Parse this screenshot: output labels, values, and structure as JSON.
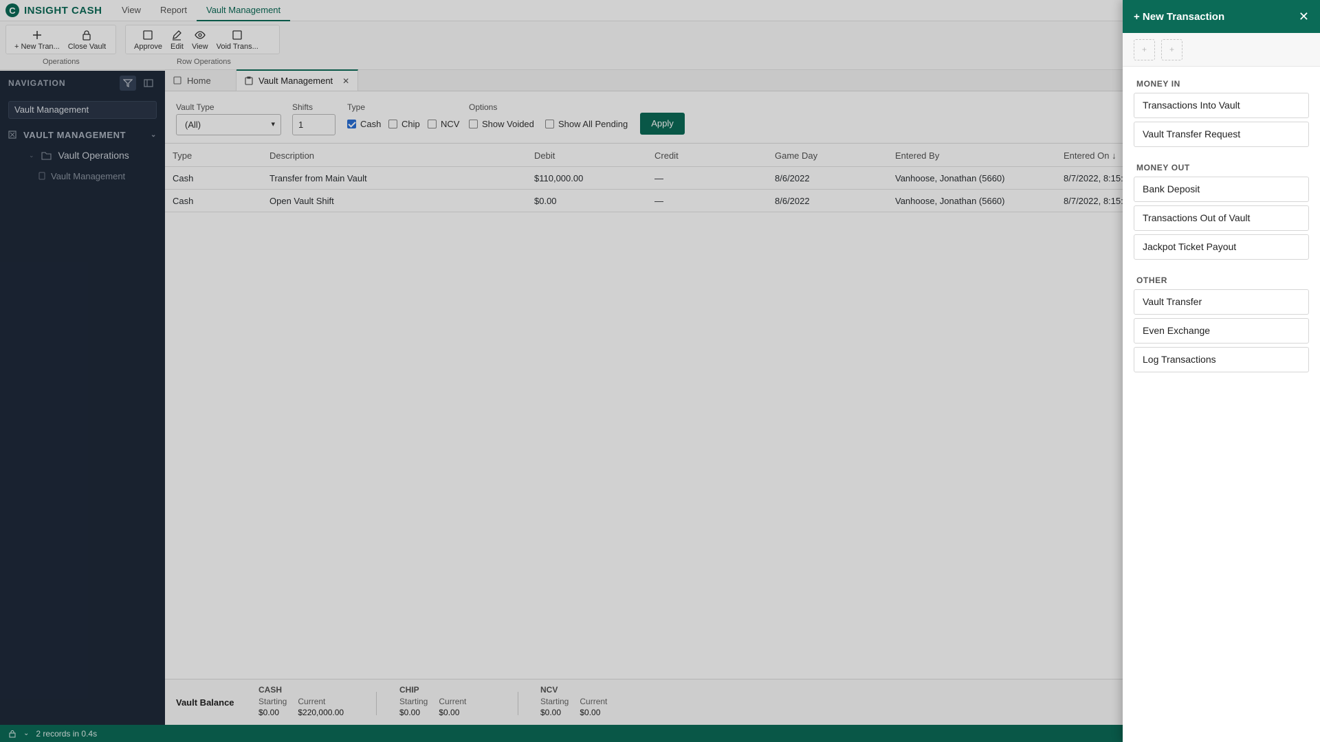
{
  "app": {
    "brand": "INSIGHT CASH",
    "menu": [
      "View",
      "Report",
      "Vault Management"
    ]
  },
  "ribbon": {
    "operations": {
      "label": "Operations",
      "new_tran": "+ New Tran...",
      "close_vault": "Close Vault"
    },
    "row_operations": {
      "label": "Row Operations",
      "approve": "Approve",
      "edit": "Edit",
      "view": "View",
      "void": "Void Trans..."
    }
  },
  "sidebar": {
    "title": "NAVIGATION",
    "search_value": "Vault Management",
    "section": "VAULT MANAGEMENT",
    "folder": "Vault Operations",
    "item": "Vault Management"
  },
  "tabs": [
    "Home",
    "Vault Management"
  ],
  "filters": {
    "vault_type_label": "Vault Type",
    "vault_type_value": "(All)",
    "shifts_label": "Shifts",
    "shifts_value": "1",
    "type_label": "Type",
    "type_cash": "Cash",
    "type_chip": "Chip",
    "type_ncv": "NCV",
    "options_label": "Options",
    "show_voided": "Show Voided",
    "show_pending": "Show All Pending",
    "apply": "Apply"
  },
  "grid": {
    "columns": [
      "Type",
      "Description",
      "Debit",
      "Credit",
      "Game Day",
      "Entered By",
      "Entered On ↓"
    ],
    "rows": [
      [
        "Cash",
        "Transfer from Main Vault",
        "$110,000.00",
        "—",
        "8/6/2022",
        "Vanhoose, Jonathan (5660)",
        "8/7/2022, 8:15:"
      ],
      [
        "Cash",
        "Open Vault Shift",
        "$0.00",
        "—",
        "8/6/2022",
        "Vanhoose, Jonathan (5660)",
        "8/7/2022, 8:15:"
      ]
    ]
  },
  "vault_balance": {
    "title": "Vault Balance",
    "starting_label": "Starting",
    "current_label": "Current",
    "cash": {
      "name": "CASH",
      "starting": "$0.00",
      "current": "$220,000.00"
    },
    "chip": {
      "name": "CHIP",
      "starting": "$0.00",
      "current": "$0.00"
    },
    "ncv": {
      "name": "NCV",
      "starting": "$0.00",
      "current": "$0.00"
    }
  },
  "status": {
    "text": "2 records in 0.4s"
  },
  "panel": {
    "title": "+ New Transaction",
    "tool_symbol": "+",
    "money_in": "MONEY IN",
    "money_in_items": [
      "Transactions Into Vault",
      "Vault Transfer Request"
    ],
    "money_out": "MONEY OUT",
    "money_out_items": [
      "Bank Deposit",
      "Transactions Out of Vault",
      "Jackpot Ticket Payout"
    ],
    "other": "OTHER",
    "other_items": [
      "Vault Transfer",
      "Even Exchange",
      "Log Transactions"
    ]
  },
  "colors": {
    "brand": "#0b6b57",
    "sidebar": "#1f2a3a"
  }
}
